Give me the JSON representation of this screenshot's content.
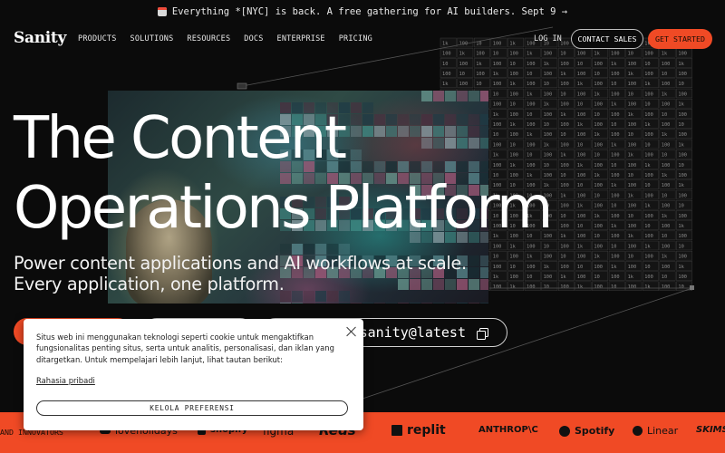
{
  "announcement": {
    "icon": "calendar-icon",
    "text": "Everything *[NYC] is back. A free gathering for AI builders. Sept 9 →"
  },
  "nav": {
    "logo": "Sanity",
    "menu": [
      "PRODUCTS",
      "SOLUTIONS",
      "RESOURCES",
      "DOCS",
      "ENTERPRISE",
      "PRICING"
    ],
    "login": "LOG IN",
    "contact": "CONTACT SALES",
    "get_started": "GET STARTED"
  },
  "hero": {
    "title_line1": "The Content",
    "title_line2": "Operations Platform",
    "subtitle_line1": "Power content applications and AI workflows at scale.",
    "subtitle_line2": "Every application, one platform.",
    "npm_command": "sanity@latest"
  },
  "cookie": {
    "text": "Situs web ini menggunakan teknologi seperti cookie untuk mengaktifkan fungsionalitas penting situs, serta untuk analitis, personalisasi, dan iklan yang ditargetkan. Untuk mempelajari lebih lanjut, lihat tautan berikut:",
    "privacy_link": "Rahasia pribadi",
    "preferences_button": "KELOLA PREFERENSI"
  },
  "logos": {
    "trusted_text": "AND INNOVATORS",
    "brands": [
      "loveholıdays",
      "shopify",
      "figma",
      "Reds",
      "replit",
      "ANTHROP\\C",
      "Spotify",
      "Linear",
      "SKIMS"
    ]
  },
  "colors": {
    "accent": "#f04a25",
    "background": "#0b0b0b"
  }
}
